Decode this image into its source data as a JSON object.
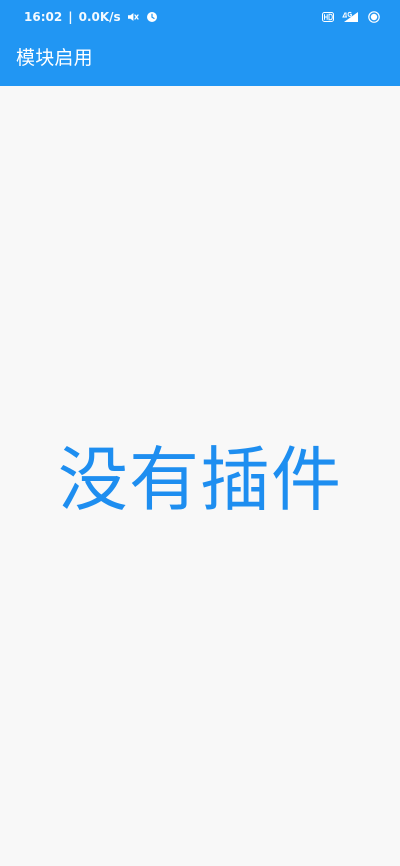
{
  "status_bar": {
    "time": "16:02",
    "speed": "0.0K/s",
    "icons": [
      "mute-icon",
      "alarm-clock-icon",
      "hd-icon",
      "4g-signal-icon",
      "battery-icon"
    ]
  },
  "app_bar": {
    "title": "模块启用",
    "color": "#2196f3"
  },
  "main": {
    "empty_text": "没有插件",
    "text_color": "#1e8ef0",
    "background": "#f8f8f8"
  }
}
